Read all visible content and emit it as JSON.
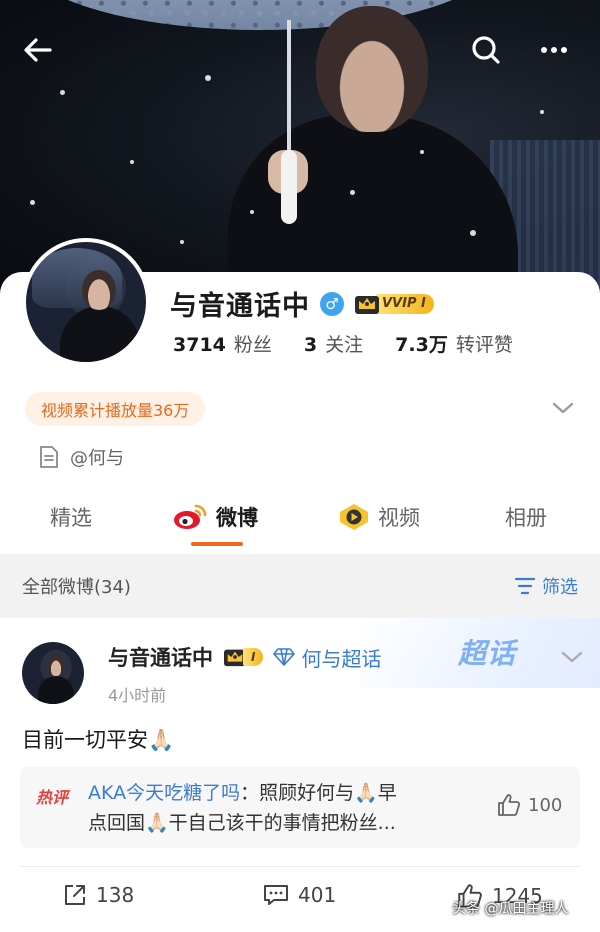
{
  "header": {
    "back_icon": "back-arrow-icon",
    "search_icon": "search-icon",
    "more_icon": "more-dots-icon"
  },
  "profile": {
    "name": "与音通话中",
    "gender_symbol": "♂",
    "vip_label": "VVIP I",
    "stats": [
      {
        "num": "3714",
        "label": "粉丝"
      },
      {
        "num": "3",
        "label": "关注"
      },
      {
        "num": "7.3万",
        "label": "转评赞"
      }
    ],
    "play_badge": "视频累计播放量36万",
    "description": "@何与"
  },
  "tabs": [
    {
      "label": "精选",
      "active": false
    },
    {
      "label": "微博",
      "active": true
    },
    {
      "label": "视频",
      "active": false
    },
    {
      "label": "相册",
      "active": false
    }
  ],
  "filter": {
    "count_label": "全部微博(34)",
    "filter_label": "筛选"
  },
  "post": {
    "author": "与音通话中",
    "vip_label": "I",
    "supertopic": "何与超话",
    "supertopic_deco": "超话",
    "time": "4小时前",
    "text": "目前一切平安🙏🏻",
    "hot_comment": {
      "badge": "热评",
      "user": "AKA今天吃糖了吗",
      "text_line1": "：照顾好何与🙏🏻早",
      "text_line2": "点回国🙏🏻干自己该干的事情把粉丝...",
      "likes": "100"
    },
    "actions": {
      "reposts": "138",
      "comments": "401",
      "likes": "1245"
    }
  },
  "watermark": "头条 @瓜田主理人",
  "colors": {
    "accent_orange": "#f26a1b",
    "link_blue": "#3a7bd5",
    "vip_gold": "#f4b41a"
  }
}
